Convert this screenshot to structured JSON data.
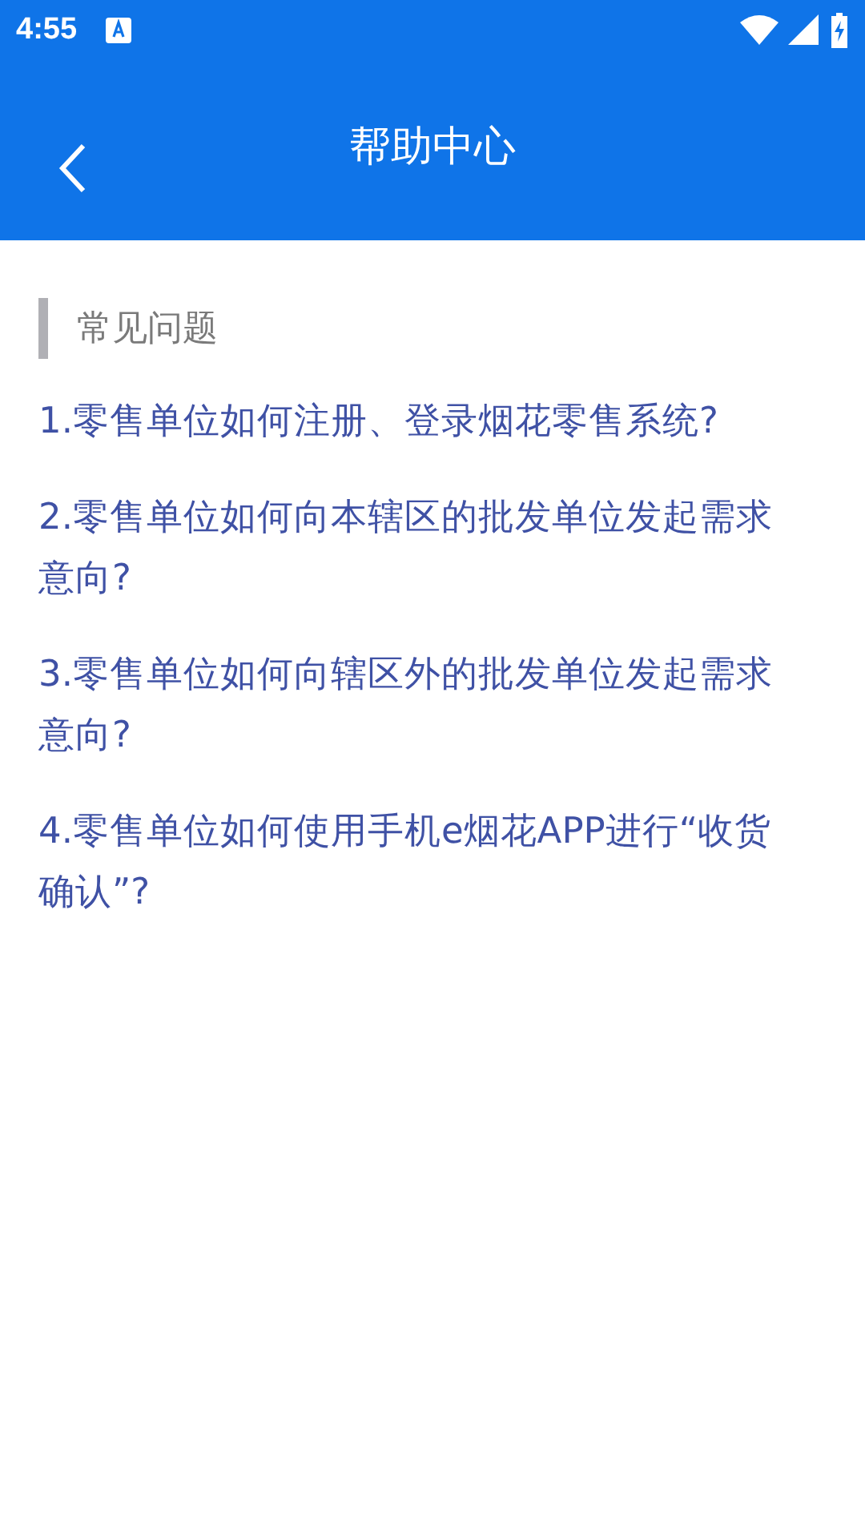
{
  "status_bar": {
    "time": "4:55"
  },
  "header": {
    "title": "帮助中心"
  },
  "section": {
    "title": "常见问题"
  },
  "questions": [
    {
      "text": "1.零售单位如何注册、登录烟花零售系统?"
    },
    {
      "text": "2.零售单位如何向本辖区的批发单位发起需求意向?"
    },
    {
      "text": "3.零售单位如何向辖区外的批发单位发起需求意向?"
    },
    {
      "text": "4.零售单位如何使用手机e烟花APP进行“收货确认”?"
    }
  ]
}
